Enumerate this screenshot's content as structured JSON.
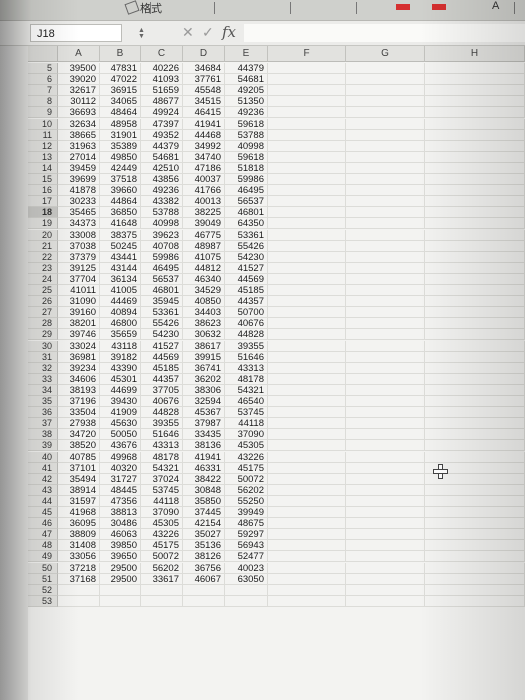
{
  "ribbon": {
    "format_label": "格式",
    "a_label": "A"
  },
  "formula_bar": {
    "cell_ref": "J18",
    "cancel_icon": "✕",
    "confirm_icon": "✓",
    "fx_label": "fx",
    "formula": ""
  },
  "columns": [
    "A",
    "B",
    "C",
    "D",
    "E",
    "F",
    "G",
    "H"
  ],
  "selected_row": "18",
  "rows": [
    {
      "n": "5",
      "v": [
        "39500",
        "47831",
        "40226",
        "34684",
        "44379"
      ]
    },
    {
      "n": "6",
      "v": [
        "39020",
        "47022",
        "41093",
        "37761",
        "54681"
      ]
    },
    {
      "n": "7",
      "v": [
        "32617",
        "36915",
        "51659",
        "45548",
        "49205"
      ]
    },
    {
      "n": "8",
      "v": [
        "30112",
        "34065",
        "48677",
        "34515",
        "51350"
      ]
    },
    {
      "n": "9",
      "v": [
        "36693",
        "48464",
        "49924",
        "46415",
        "49236"
      ]
    },
    {
      "n": "10",
      "v": [
        "32634",
        "48958",
        "47397",
        "41941",
        "59618"
      ]
    },
    {
      "n": "11",
      "v": [
        "38665",
        "31901",
        "49352",
        "44468",
        "53788"
      ]
    },
    {
      "n": "12",
      "v": [
        "31963",
        "35389",
        "44379",
        "34992",
        "40998"
      ]
    },
    {
      "n": "13",
      "v": [
        "27014",
        "49850",
        "54681",
        "34740",
        "59618"
      ]
    },
    {
      "n": "14",
      "v": [
        "39459",
        "42449",
        "42510",
        "47186",
        "51818"
      ]
    },
    {
      "n": "15",
      "v": [
        "39699",
        "37518",
        "43856",
        "40037",
        "59986"
      ]
    },
    {
      "n": "16",
      "v": [
        "41878",
        "39660",
        "49236",
        "41766",
        "46495"
      ]
    },
    {
      "n": "17",
      "v": [
        "30233",
        "44864",
        "43382",
        "40013",
        "56537"
      ]
    },
    {
      "n": "18",
      "v": [
        "35465",
        "36850",
        "53788",
        "38225",
        "46801"
      ]
    },
    {
      "n": "19",
      "v": [
        "34373",
        "41648",
        "40998",
        "39049",
        "64350"
      ]
    },
    {
      "n": "20",
      "v": [
        "33008",
        "38375",
        "39623",
        "46775",
        "53361"
      ]
    },
    {
      "n": "21",
      "v": [
        "37038",
        "50245",
        "40708",
        "48987",
        "55426"
      ]
    },
    {
      "n": "22",
      "v": [
        "37379",
        "43441",
        "59986",
        "41075",
        "54230"
      ]
    },
    {
      "n": "23",
      "v": [
        "39125",
        "43144",
        "46495",
        "44812",
        "41527"
      ]
    },
    {
      "n": "24",
      "v": [
        "37704",
        "36134",
        "56537",
        "46340",
        "44569"
      ]
    },
    {
      "n": "25",
      "v": [
        "41011",
        "41005",
        "46801",
        "34529",
        "45185"
      ]
    },
    {
      "n": "26",
      "v": [
        "31090",
        "44469",
        "35945",
        "40850",
        "44357"
      ]
    },
    {
      "n": "27",
      "v": [
        "39160",
        "40894",
        "53361",
        "34403",
        "50700"
      ]
    },
    {
      "n": "28",
      "v": [
        "38201",
        "46800",
        "55426",
        "38623",
        "40676"
      ]
    },
    {
      "n": "29",
      "v": [
        "39746",
        "35659",
        "54230",
        "30632",
        "44828"
      ]
    },
    {
      "n": "30",
      "v": [
        "33024",
        "43118",
        "41527",
        "38617",
        "39355"
      ]
    },
    {
      "n": "31",
      "v": [
        "36981",
        "39182",
        "44569",
        "39915",
        "51646"
      ]
    },
    {
      "n": "32",
      "v": [
        "39234",
        "43390",
        "45185",
        "36741",
        "43313"
      ]
    },
    {
      "n": "33",
      "v": [
        "34606",
        "45301",
        "44357",
        "36202",
        "48178"
      ]
    },
    {
      "n": "34",
      "v": [
        "38193",
        "44699",
        "37705",
        "38306",
        "54321"
      ]
    },
    {
      "n": "35",
      "v": [
        "37196",
        "39430",
        "40676",
        "32594",
        "46540"
      ]
    },
    {
      "n": "36",
      "v": [
        "33504",
        "41909",
        "44828",
        "45367",
        "53745"
      ]
    },
    {
      "n": "37",
      "v": [
        "27938",
        "45630",
        "39355",
        "37987",
        "44118"
      ]
    },
    {
      "n": "38",
      "v": [
        "34720",
        "50050",
        "51646",
        "33435",
        "37090"
      ]
    },
    {
      "n": "39",
      "v": [
        "38520",
        "43676",
        "43313",
        "38136",
        "45305"
      ]
    },
    {
      "n": "40",
      "v": [
        "40785",
        "49968",
        "48178",
        "41941",
        "43226"
      ]
    },
    {
      "n": "41",
      "v": [
        "37101",
        "40320",
        "54321",
        "46331",
        "45175"
      ]
    },
    {
      "n": "42",
      "v": [
        "35494",
        "31727",
        "37024",
        "38422",
        "50072"
      ]
    },
    {
      "n": "43",
      "v": [
        "38914",
        "48445",
        "53745",
        "30848",
        "56202"
      ]
    },
    {
      "n": "44",
      "v": [
        "31597",
        "47356",
        "44118",
        "35850",
        "55250"
      ]
    },
    {
      "n": "45",
      "v": [
        "41968",
        "38813",
        "37090",
        "37445",
        "39949"
      ]
    },
    {
      "n": "46",
      "v": [
        "36095",
        "30486",
        "45305",
        "42154",
        "48675"
      ]
    },
    {
      "n": "47",
      "v": [
        "38809",
        "46063",
        "43226",
        "35027",
        "59297"
      ]
    },
    {
      "n": "48",
      "v": [
        "31408",
        "39850",
        "45175",
        "35136",
        "56943"
      ]
    },
    {
      "n": "49",
      "v": [
        "33056",
        "39650",
        "50072",
        "38126",
        "52477"
      ]
    },
    {
      "n": "50",
      "v": [
        "37218",
        "29500",
        "56202",
        "36756",
        "40023"
      ]
    },
    {
      "n": "51",
      "v": [
        "37168",
        "29500",
        "33617",
        "46067",
        "63050"
      ]
    },
    {
      "n": "52",
      "v": [
        "",
        "",
        "",
        "",
        ""
      ]
    },
    {
      "n": "53",
      "v": [
        "",
        "",
        "",
        "",
        ""
      ]
    }
  ]
}
